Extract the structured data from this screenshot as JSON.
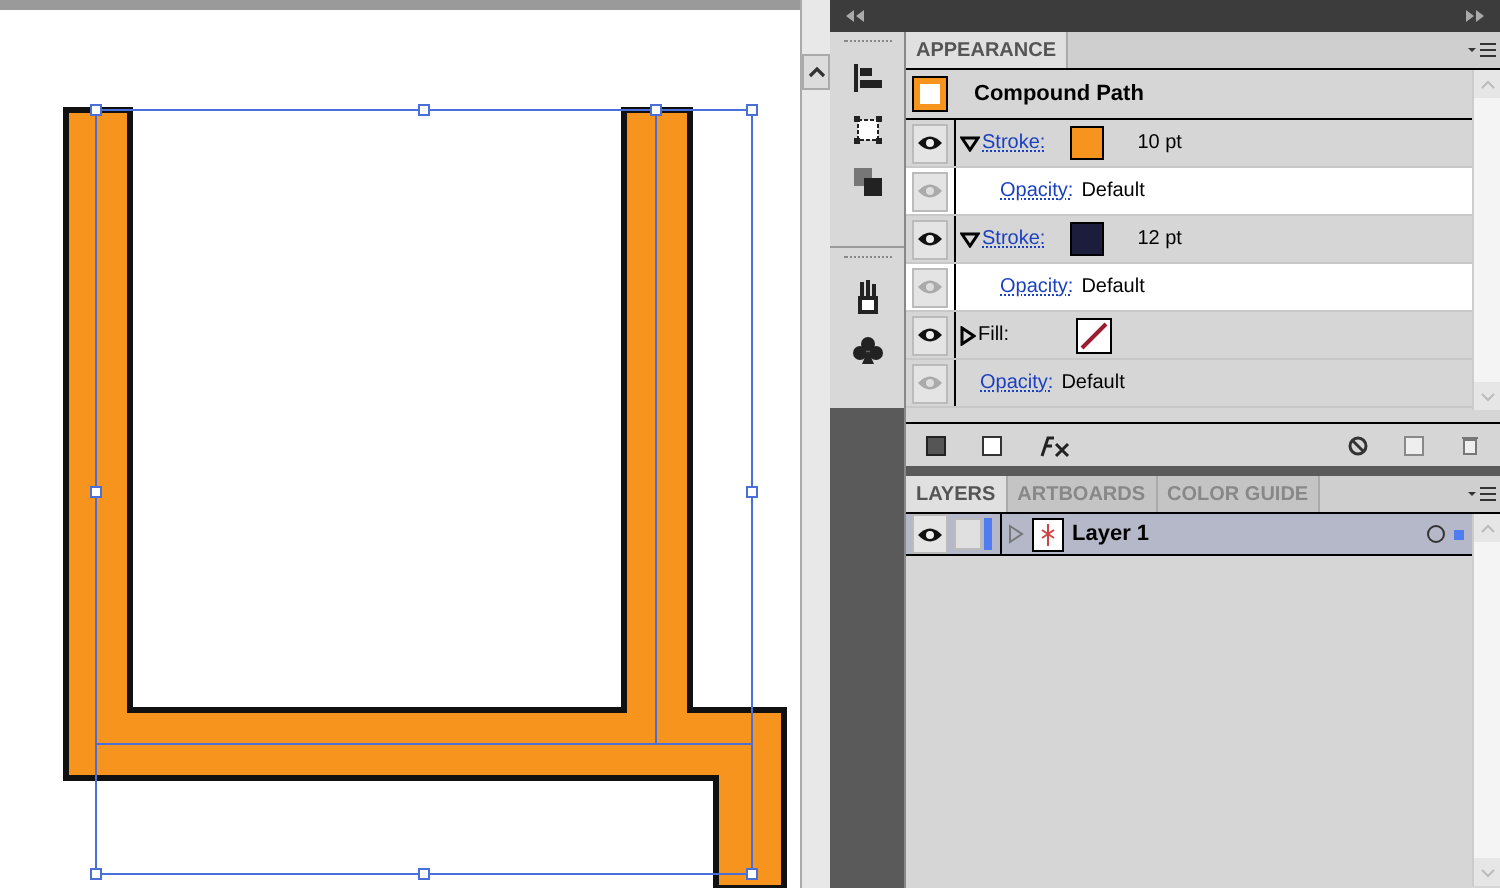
{
  "appearance": {
    "tab": "APPEARANCE",
    "title": "Compound Path",
    "rows": [
      {
        "kind": "stroke",
        "label": "Stroke:",
        "color": "#f7941d",
        "value": "10 pt",
        "visible": true,
        "expanded": true
      },
      {
        "kind": "opacity",
        "label": "Opacity:",
        "value": "Default",
        "visible": false,
        "indent": true
      },
      {
        "kind": "stroke",
        "label": "Stroke:",
        "color": "#1c1c3c",
        "value": "12 pt",
        "visible": true,
        "expanded": true
      },
      {
        "kind": "opacity",
        "label": "Opacity:",
        "value": "Default",
        "visible": false,
        "indent": true
      },
      {
        "kind": "fill",
        "label": "Fill:",
        "visible": true,
        "expanded": false
      },
      {
        "kind": "opacity",
        "label": "Opacity:",
        "value": "Default",
        "visible": false,
        "indent": false
      }
    ]
  },
  "layers_panel": {
    "tabs": [
      {
        "label": "LAYERS",
        "selected": true
      },
      {
        "label": "ARTBOARDS",
        "selected": false
      },
      {
        "label": "COLOR GUIDE",
        "selected": false
      }
    ],
    "layers": [
      {
        "name": "Layer 1",
        "visible": true,
        "expanded": false
      }
    ]
  }
}
